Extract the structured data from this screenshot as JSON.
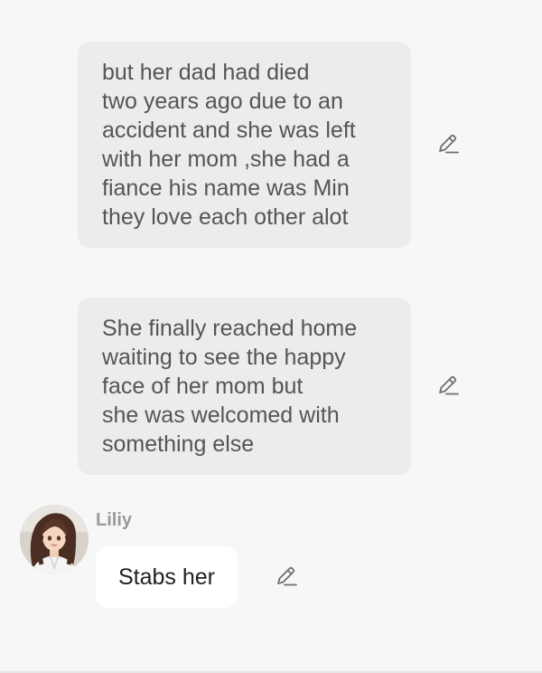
{
  "messages": [
    {
      "role": "user",
      "text": "but her dad had died\ntwo years ago due to an\naccident and she was left\nwith her mom ,she had a\nfiance his name was Min\nthey love each other alot"
    },
    {
      "role": "user",
      "text": "She finally reached home\nwaiting to see the happy\nface of her mom but\nshe was welcomed with\nsomething else"
    },
    {
      "role": "character",
      "name": "Liliy",
      "text": "Stabs her"
    }
  ],
  "icons": {
    "edit": "pencil-edit-icon",
    "avatar": "character-avatar"
  },
  "colors": {
    "page_background": "#f7f7f7",
    "user_bubble": "#ececec",
    "character_bubble": "#ffffff",
    "user_text": "#555555",
    "character_text": "#222222",
    "name_text": "#9a9a9a",
    "icon": "#6f6f6f"
  }
}
